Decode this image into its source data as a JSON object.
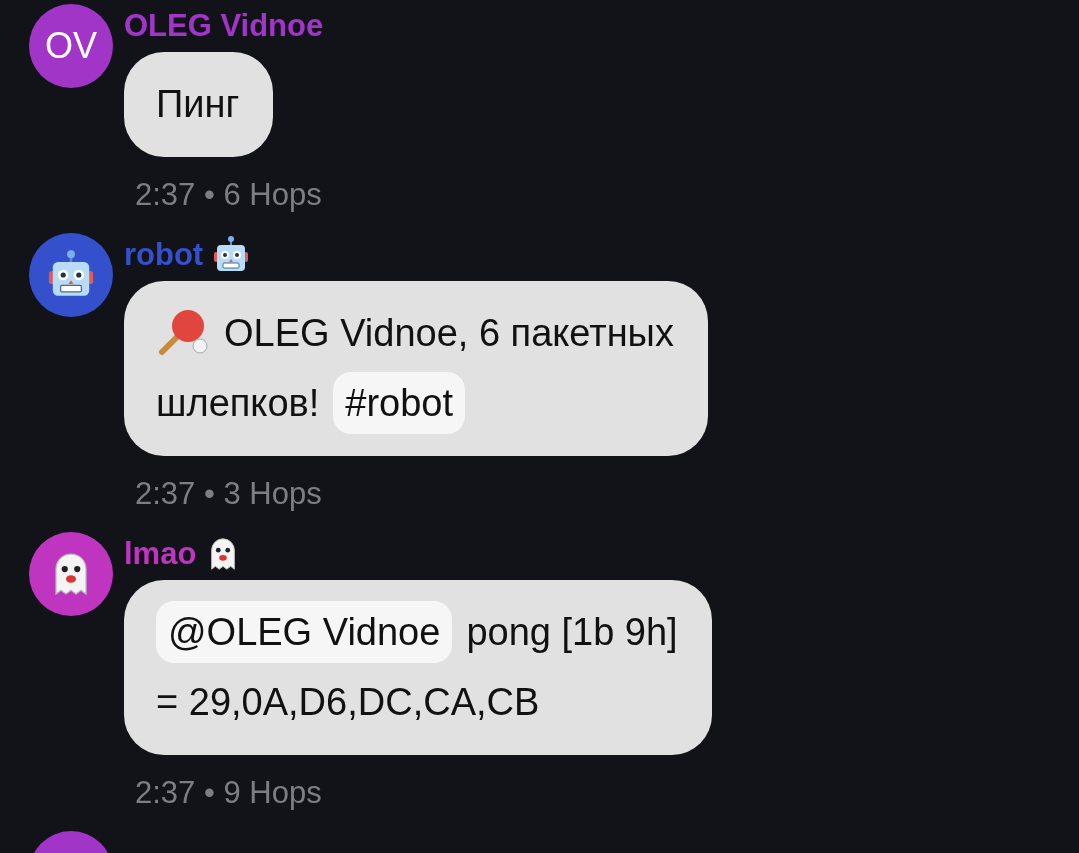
{
  "messages": [
    {
      "sender": "OLEG Vidnoe",
      "color": "#a035c8",
      "avatar": {
        "kind": "initials",
        "text": "OV"
      },
      "lines": [
        [
          {
            "kind": "text",
            "text": "Пинг"
          }
        ]
      ],
      "time": "2:37 • 6 Hops"
    },
    {
      "sender": "robot",
      "color": "#3550cc",
      "avatar": {
        "kind": "robot"
      },
      "lines": [
        [
          {
            "kind": "paddle"
          },
          {
            "kind": "text",
            "text": "OLEG Vidnoe, 6 пакетных"
          }
        ],
        [
          {
            "kind": "text",
            "text": "шлепков!"
          },
          {
            "kind": "tag",
            "text": "#robot"
          }
        ]
      ],
      "time": "2:37 • 3 Hops"
    },
    {
      "sender": "lmao",
      "color": "#c035c0",
      "avatar": {
        "kind": "ghost"
      },
      "lines": [
        [
          {
            "kind": "mention",
            "text": "@OLEG Vidnoe"
          },
          {
            "kind": "text",
            "text": "pong [1b 9h]"
          }
        ],
        [
          {
            "kind": "text",
            "text": "= 29,0A,D6,DC,CA,CB"
          }
        ]
      ],
      "time": "2:37 • 9 Hops"
    },
    {
      "color": "#a035c8",
      "avatar": {
        "kind": "blank"
      }
    }
  ]
}
